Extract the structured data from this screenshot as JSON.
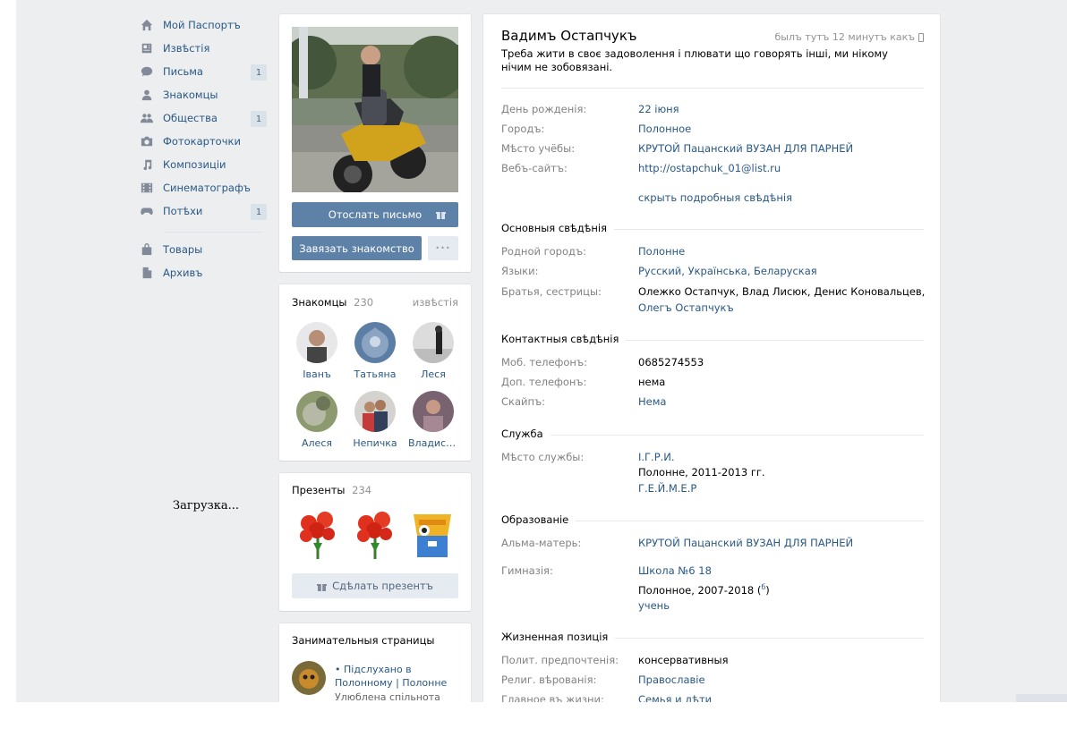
{
  "menu": {
    "items": [
      {
        "label": "Мой Паспортъ",
        "icon": "home-icon",
        "count": ""
      },
      {
        "label": "Извѣстія",
        "icon": "news-icon",
        "count": ""
      },
      {
        "label": "Письма",
        "icon": "messages-icon",
        "count": "1"
      },
      {
        "label": "Знакомцы",
        "icon": "friends-icon",
        "count": ""
      },
      {
        "label": "Общества",
        "icon": "groups-icon",
        "count": "1"
      },
      {
        "label": "Фотокарточки",
        "icon": "camera-icon",
        "count": ""
      },
      {
        "label": "Композиціи",
        "icon": "music-icon",
        "count": ""
      },
      {
        "label": "Синематографъ",
        "icon": "video-icon",
        "count": ""
      },
      {
        "label": "Потѣхи",
        "icon": "gamepad-icon",
        "count": "1"
      },
      {
        "label": "Товары",
        "icon": "bag-icon",
        "count": ""
      },
      {
        "label": "Архивъ",
        "icon": "file-icon",
        "count": ""
      }
    ],
    "loading": "Загрузка..."
  },
  "profile_actions": {
    "send_message": "Отослать письмо",
    "add_friend": "Завязать знакомство",
    "more": "•••"
  },
  "friends": {
    "title": "Знакомцы",
    "count": "230",
    "updates_link": "извѣстія",
    "list": [
      "Іванъ",
      "Татьяна",
      "Леся",
      "Алеся",
      "Непичка",
      "Владислав..."
    ]
  },
  "gifts": {
    "title": "Презенты",
    "count": "234",
    "button": "Сдѣлать презентъ"
  },
  "pages": {
    "title": "Занимательныя страницы",
    "item_title": "• Підслухано в Полонному | Полонне",
    "item_desc": "Улюблена спільнота"
  },
  "profile": {
    "name": "Вадимъ Остапчукъ",
    "online": "былъ тутъ 12 минутъ какъ",
    "status": "Треба жити в своє задоволення і плювати що говорять інші, ми нікому нічим не зобовязані.",
    "brief": [
      {
        "label": "День рожденія:",
        "value": "22 іюня",
        "link": true
      },
      {
        "label": "Городъ:",
        "value": "Полонное",
        "link": true
      },
      {
        "label": "Мѣсто учёбы:",
        "value": "КРУТОЙ Пацанский ВУЗАН ДЛЯ ПАРНЕЙ",
        "link": true
      },
      {
        "label": "Вебъ-сайтъ:",
        "value": "http://ostapchuk_01@list.ru",
        "link": true
      }
    ],
    "hide_details": "скрыть подробныя свѣдѣнія",
    "sections": {
      "main": {
        "title": "Основныя свѣдѣнія",
        "rows": [
          {
            "label": "Родной городъ:",
            "value": "Полонне"
          },
          {
            "label": "Языки:",
            "value": "Русский, Українська, Беларуская"
          },
          {
            "label": "Братья, сестрицы:",
            "value": "Олежко Остапчук, Влад Лисюк, Денис Коновальцев,",
            "value2": "Олегъ Остапчукъ"
          }
        ]
      },
      "contacts": {
        "title": "Контактныя свѣдѣнія",
        "rows": [
          {
            "label": "Моб. телефонъ:",
            "value": "0685274553"
          },
          {
            "label": "Доп. телефонъ:",
            "value": "нема"
          },
          {
            "label": "Скайпъ:",
            "value": "Нема"
          }
        ]
      },
      "career": {
        "title": "Служба",
        "label": "Мѣсто службы:",
        "place": "І.Г.Р.И.",
        "period": "Полонне, 2011-2013 гг.",
        "position": "Г.Е.Й.М.Е.Р"
      },
      "education": {
        "title": "Образованіе",
        "university_label": "Альма-матерь:",
        "university": "КРУТОЙ Пацанский ВУЗАН ДЛЯ ПАРНЕЙ",
        "school_label": "Гимназія:",
        "school": "Школа №6 18",
        "school_period": "Полонное, 2007-2018 (",
        "school_class": "б",
        "school_period_end": ")",
        "school_spec": "учень"
      },
      "life": {
        "title": "Жизненная позиція",
        "rows": [
          {
            "label": "Полит. предпочтенія:",
            "value": "консервативныя"
          },
          {
            "label": "Религ. вѣрованія:",
            "value": "Православіе"
          },
          {
            "label": "Главное въ жизни:",
            "value": "Семья и дѣти"
          }
        ]
      }
    }
  }
}
